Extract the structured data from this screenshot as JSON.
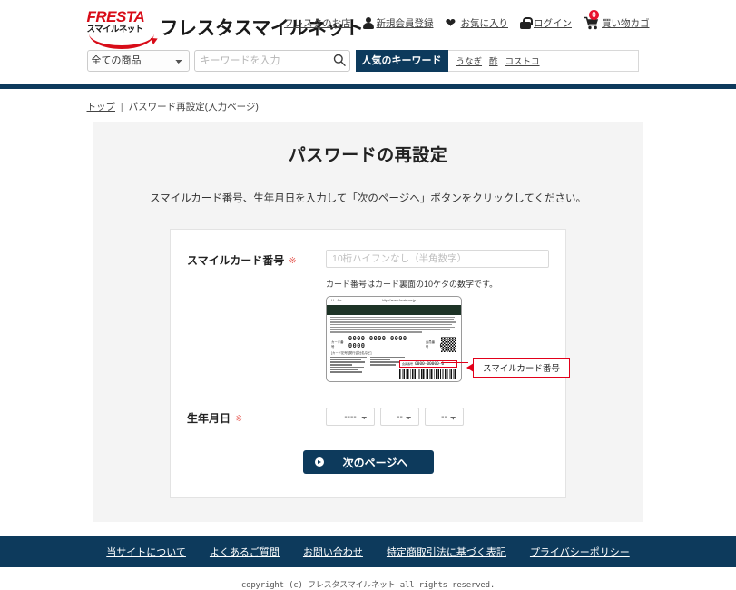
{
  "header": {
    "logo": {
      "mark_top": "FRESTA",
      "mark_sub": "スマイルネット",
      "wordmark": "フレスタスマイルネット"
    },
    "nav": [
      {
        "label": "フレスタのお店",
        "icon": ""
      },
      {
        "label": "新規会員登録",
        "icon": "person-icon"
      },
      {
        "label": "お気に入り",
        "icon": "heart-icon"
      },
      {
        "label": "ログイン",
        "icon": "lock-icon"
      },
      {
        "label": "買い物カゴ",
        "icon": "cart-icon",
        "badge": "0"
      }
    ],
    "search": {
      "category_selected": "全ての商品",
      "keyword_value": "",
      "keyword_placeholder": "キーワードを入力",
      "search_icon": "search-icon",
      "popular_button": "人気のキーワード",
      "popular_keywords": [
        "うなぎ",
        "酢",
        "コストコ"
      ]
    }
  },
  "breadcrumb": {
    "home": "トップ",
    "separator": "|",
    "current": "パスワード再設定(入力ページ)"
  },
  "main": {
    "title": "パスワードの再設定",
    "description": "スマイルカード番号、生年月日を入力して「次のページへ」ボタンをクリックしてください。",
    "form": {
      "card_number": {
        "label": "スマイルカード番号",
        "required_mark": "※",
        "value": "",
        "placeholder": "10桁ハイフンなし（半角数字）",
        "note": "カード番号はカード裏面の10ケタの数字です。"
      },
      "card_image": {
        "corner_text": "H・Co",
        "url_text": "http://www.fresta.co.jp",
        "main_number": "0000 0000 0000 0000",
        "sub_number_label": "会員番号",
        "sub_number": "0000",
        "sub_caption": "[カード記号][発行会社名など]",
        "highlight_label": "会員番号",
        "highlight_number": "0000-00000-0",
        "callout_label": "スマイルカード番号"
      },
      "birthday": {
        "label": "生年月日",
        "required_mark": "※",
        "year_selected": "----",
        "month_selected": "--",
        "day_selected": "--"
      },
      "submit_label": "次のページへ"
    }
  },
  "footer": {
    "links": [
      "当サイトについて",
      "よくあるご質問",
      "お問い合わせ",
      "特定商取引法に基づく表記",
      "プライバシーポリシー"
    ],
    "copyright": "copyright (c) フレスタスマイルネット all rights reserved."
  }
}
